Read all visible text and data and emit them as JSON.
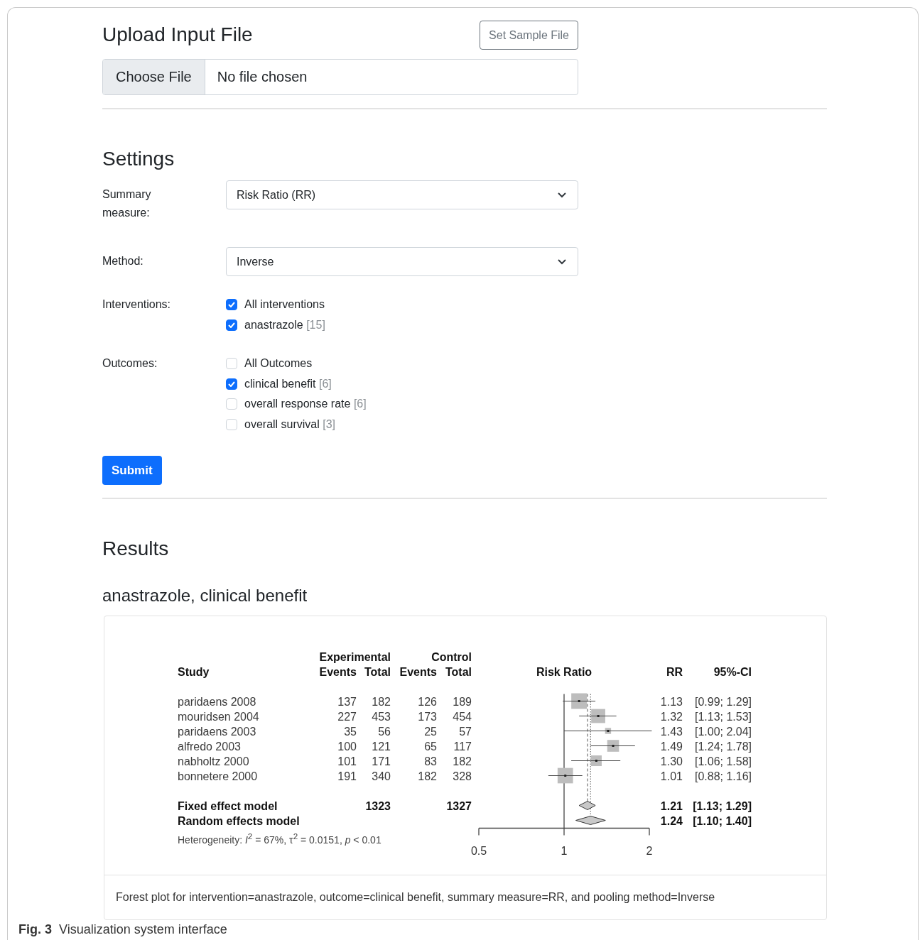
{
  "upload": {
    "title": "Upload Input File",
    "sample_button": "Set Sample File",
    "file_button": "Choose File",
    "file_status": "No file chosen"
  },
  "settings": {
    "title": "Settings",
    "fields": [
      {
        "kind": "select",
        "label": "Summary measure:",
        "value": "Risk Ratio (RR)"
      },
      {
        "kind": "select",
        "label": "Method:",
        "value": "Inverse"
      },
      {
        "kind": "checkboxes",
        "label": "Interventions:",
        "options": [
          {
            "label": "All interventions",
            "checked": true
          },
          {
            "label": "anastrazole",
            "count": "[15]",
            "checked": true
          }
        ]
      },
      {
        "kind": "checkboxes",
        "label": "Outcomes:",
        "options": [
          {
            "label": "All Outcomes",
            "checked": false
          },
          {
            "label": "clinical benefit",
            "count": "[6]",
            "checked": true
          },
          {
            "label": "overall response rate",
            "count": "[6]",
            "checked": false
          },
          {
            "label": "overall survival",
            "count": "[3]",
            "checked": false
          }
        ]
      }
    ],
    "submit": "Submit"
  },
  "results": {
    "title": "Results",
    "subtitle": "anastrazole, clinical benefit",
    "plot": {
      "header": {
        "study": "Study",
        "group_1": "Experimental",
        "group_2": "Control",
        "columns": [
          "Events",
          "Total",
          "Events",
          "Total"
        ],
        "effect": "Risk Ratio",
        "rr": "RR",
        "ci": "95%-CI"
      },
      "studies": [
        {
          "name": "paridaens 2008",
          "values": [
            "137",
            "182",
            "126",
            "189"
          ],
          "rr": "1.13",
          "ci": "[0.99; 1.29]"
        },
        {
          "name": "mouridsen 2004",
          "values": [
            "227",
            "453",
            "173",
            "454"
          ],
          "rr": "1.32",
          "ci": "[1.13; 1.53]"
        },
        {
          "name": "paridaens 2003",
          "values": [
            "35",
            "56",
            "25",
            "57"
          ],
          "rr": "1.43",
          "ci": "[1.00; 2.04]"
        },
        {
          "name": "alfredo 2003",
          "values": [
            "100",
            "121",
            "65",
            "117"
          ],
          "rr": "1.49",
          "ci": "[1.24; 1.78]"
        },
        {
          "name": "nabholtz 2000",
          "values": [
            "101",
            "171",
            "83",
            "182"
          ],
          "rr": "1.30",
          "ci": "[1.06; 1.58]"
        },
        {
          "name": "bonnetere 2000",
          "values": [
            "191",
            "340",
            "182",
            "328"
          ],
          "rr": "1.01",
          "ci": "[0.88; 1.16]"
        }
      ],
      "models": [
        {
          "kind": "fixed",
          "name": "Fixed effect model",
          "exp_total": "1323",
          "ctrl_total": "1327",
          "rr": "1.21",
          "ci": "[1.13; 1.29]"
        },
        {
          "kind": "random",
          "name": "Random effects model",
          "rr": "1.24",
          "ci": "[1.10; 1.40]"
        }
      ],
      "heterogeneity": "Heterogeneity: *I*$^{2}$ = 67%, τ$^{2}$ = 0.0151, *p* < 0.01",
      "ticks": [
        "0.5",
        "1",
        "2"
      ]
    },
    "caption": "Forest plot for intervention=anastrazole, outcome=clinical benefit, summary measure=RR, and pooling method=Inverse"
  },
  "figure_caption": {
    "number": "Fig. 3",
    "text": "Visualization system interface"
  }
}
